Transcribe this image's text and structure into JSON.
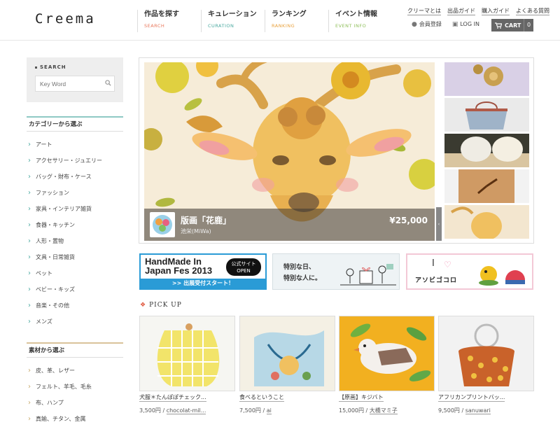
{
  "header": {
    "logo": "Creema",
    "nav": [
      {
        "ja": "作品を探す",
        "en": "SEARCH",
        "color": "#e8765a"
      },
      {
        "ja": "キュレーション",
        "en": "CURATION",
        "color": "#4aa9a0"
      },
      {
        "ja": "ランキング",
        "en": "RANKING",
        "color": "#e8a03a"
      },
      {
        "ja": "イベント情報",
        "en": "EVENT INFO",
        "color": "#8fbf5a"
      }
    ],
    "util_links": [
      "クリーマとは",
      "出品ガイド",
      "購入ガイド",
      "よくある質問"
    ],
    "register": "会員登録",
    "login": "LOG IN",
    "cart_label": "CART",
    "cart_count": "0"
  },
  "sidebar": {
    "search_title": "SEARCH",
    "search_placeholder": "Key Word",
    "category_title": "カテゴリーから選ぶ",
    "categories": [
      "アート",
      "アクセサリー・ジュエリー",
      "バッグ・財布・ケース",
      "ファッション",
      "家具・インテリア雑貨",
      "食器・キッチン",
      "人形・置物",
      "文具・日常雑貨",
      "ペット",
      "ベビー・キッズ",
      "音楽・その他",
      "メンズ"
    ],
    "material_title": "素材から選ぶ",
    "materials": [
      "皮、革、レザー",
      "フェルト、羊毛、毛糸",
      "布、ハンプ",
      "真鍮、チタン、金属"
    ]
  },
  "hero": {
    "title": "版画「花鹿」",
    "author": "池栄(MiWa)",
    "price": "¥25,000",
    "handle": "‹"
  },
  "banners": {
    "b1_line1": "HandMade In",
    "b1_line2": "Japan Fes 2013",
    "b1_badge_1": "公式サイト",
    "b1_badge_2": "OPEN",
    "b1_bottom": ">> 出展受付スタート！",
    "b2_line1": "特別な日、",
    "b2_line2": "特別な人に。",
    "b3_i": "I",
    "b3_text": "アソビゴコロ"
  },
  "pickup": {
    "title": "PICK UP",
    "items": [
      {
        "name": "犬服＊たんぽぽチェック...",
        "price": "3,500円",
        "seller": "chocolat-mil..."
      },
      {
        "name": "食べるということ",
        "price": "7,500円",
        "seller": "ai"
      },
      {
        "name": "【原画】キジバト",
        "price": "15,000円",
        "seller": "大橋マミ子"
      },
      {
        "name": "アフリカンプリントバッ...",
        "price": "9,500円",
        "seller": "sanuwari"
      }
    ]
  },
  "colors": {
    "accent_teal": "#8ec9c4",
    "material_gold": "#d9c39a",
    "banner_blue": "#2a9bd6"
  }
}
